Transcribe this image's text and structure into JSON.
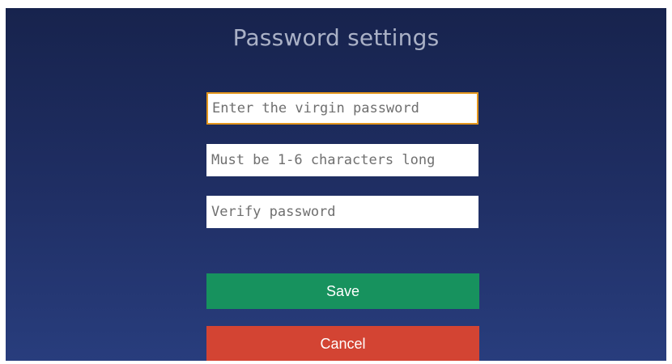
{
  "dialog": {
    "title": "Password settings"
  },
  "fields": {
    "original_password": {
      "value": "",
      "placeholder": "Enter the virgin password"
    },
    "new_password": {
      "value": "",
      "placeholder": "Must be 1-6 characters long"
    },
    "verify_password": {
      "value": "",
      "placeholder": "Verify password"
    }
  },
  "buttons": {
    "save_label": "Save",
    "cancel_label": "Cancel"
  },
  "colors": {
    "save": "#17925e",
    "cancel": "#d34433",
    "focus_border": "#e3961c"
  }
}
